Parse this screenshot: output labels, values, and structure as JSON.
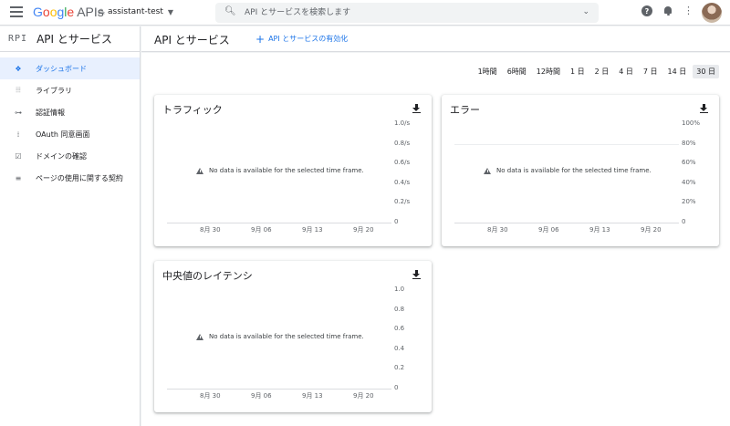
{
  "topbar": {
    "logo_google": "Google",
    "logo_apis": "APIs",
    "project_name": "assistant-test",
    "search_placeholder": "API とサービスを検索します",
    "help_icon": "?"
  },
  "sidebar": {
    "logo_text": "RPI",
    "title": "API とサービス",
    "items": [
      {
        "label": "ダッシュボード",
        "icon": "dashboard-icon",
        "glyph": "❖",
        "active": true
      },
      {
        "label": "ライブラリ",
        "icon": "library-icon",
        "glyph": "⦙⦙⦙",
        "active": false
      },
      {
        "label": "認証情報",
        "icon": "key-icon",
        "glyph": "⊶",
        "active": false
      },
      {
        "label": "OAuth 同意画面",
        "icon": "consent-icon",
        "glyph": "⁞",
        "active": false
      },
      {
        "label": "ドメインの確認",
        "icon": "domain-check-icon",
        "glyph": "☑",
        "active": false
      },
      {
        "label": "ページの使用に関する契約",
        "icon": "agreement-icon",
        "glyph": "≡",
        "active": false
      }
    ]
  },
  "main": {
    "title": "API とサービス",
    "enable_api_label": "API とサービスの有効化",
    "time_ranges": [
      "1時間",
      "6時間",
      "12時間",
      "1 日",
      "2 日",
      "4 日",
      "7 日",
      "14 日",
      "30 日"
    ],
    "selected_time_range": "30 日",
    "no_data_text": "No data is available for the selected time frame."
  },
  "charts": {
    "traffic": {
      "title": "トラフィック",
      "y_ticks": [
        "1.0/s",
        "0.8/s",
        "0.6/s",
        "0.4/s",
        "0.2/s",
        "0"
      ],
      "x_ticks": [
        "8月 30",
        "9月 06",
        "9月 13",
        "9月 20"
      ]
    },
    "errors": {
      "title": "エラー",
      "y_ticks": [
        "100%",
        "80%",
        "60%",
        "40%",
        "20%",
        "0"
      ],
      "x_ticks": [
        "8月 30",
        "9月 06",
        "9月 13",
        "9月 20"
      ]
    },
    "latency": {
      "title": "中央値のレイテンシ",
      "y_ticks": [
        "1.0",
        "0.8",
        "0.6",
        "0.4",
        "0.2",
        "0"
      ],
      "x_ticks": [
        "8月 30",
        "9月 06",
        "9月 13",
        "9月 20"
      ]
    }
  },
  "colors": {
    "accent": "#1a73e8",
    "active_bg": "#e8f0fe"
  }
}
